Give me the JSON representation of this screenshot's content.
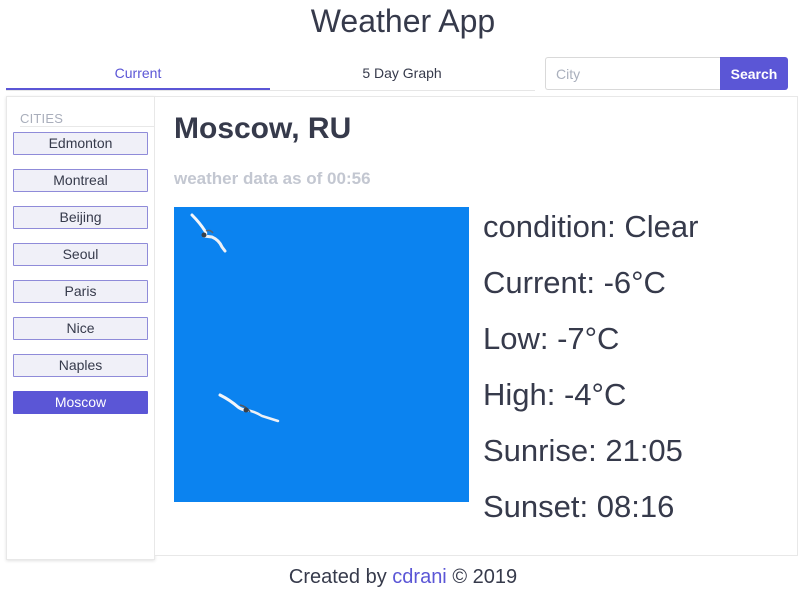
{
  "header": {
    "title": "Weather App"
  },
  "tabs": [
    {
      "label": "Current",
      "active": true
    },
    {
      "label": "5 Day Graph",
      "active": false
    }
  ],
  "search": {
    "placeholder": "City",
    "value": "",
    "button_label": "Search"
  },
  "sidebar": {
    "label": "CITIES",
    "cities": [
      "Edmonton",
      "Montreal",
      "Beijing",
      "Seoul",
      "Paris",
      "Nice",
      "Naples",
      "Moscow"
    ],
    "selected": "Moscow"
  },
  "weather": {
    "city": "Moscow, RU",
    "timestamp": "weather data as of 00:56",
    "image": {
      "description": "two seagulls against clear blue sky",
      "sky_color": "#0b83f0"
    },
    "stats": [
      "condition: Clear",
      "Current: -6°C",
      "Low: -7°C",
      "High: -4°C",
      "Sunrise: 21:05",
      "Sunset: 08:16"
    ]
  },
  "footer": {
    "prefix": "Created by",
    "author": "cdrani",
    "suffix": "© 2019"
  },
  "colors": {
    "accent": "#5b56d6",
    "text": "#363a4b",
    "muted": "#c3c7d1"
  }
}
